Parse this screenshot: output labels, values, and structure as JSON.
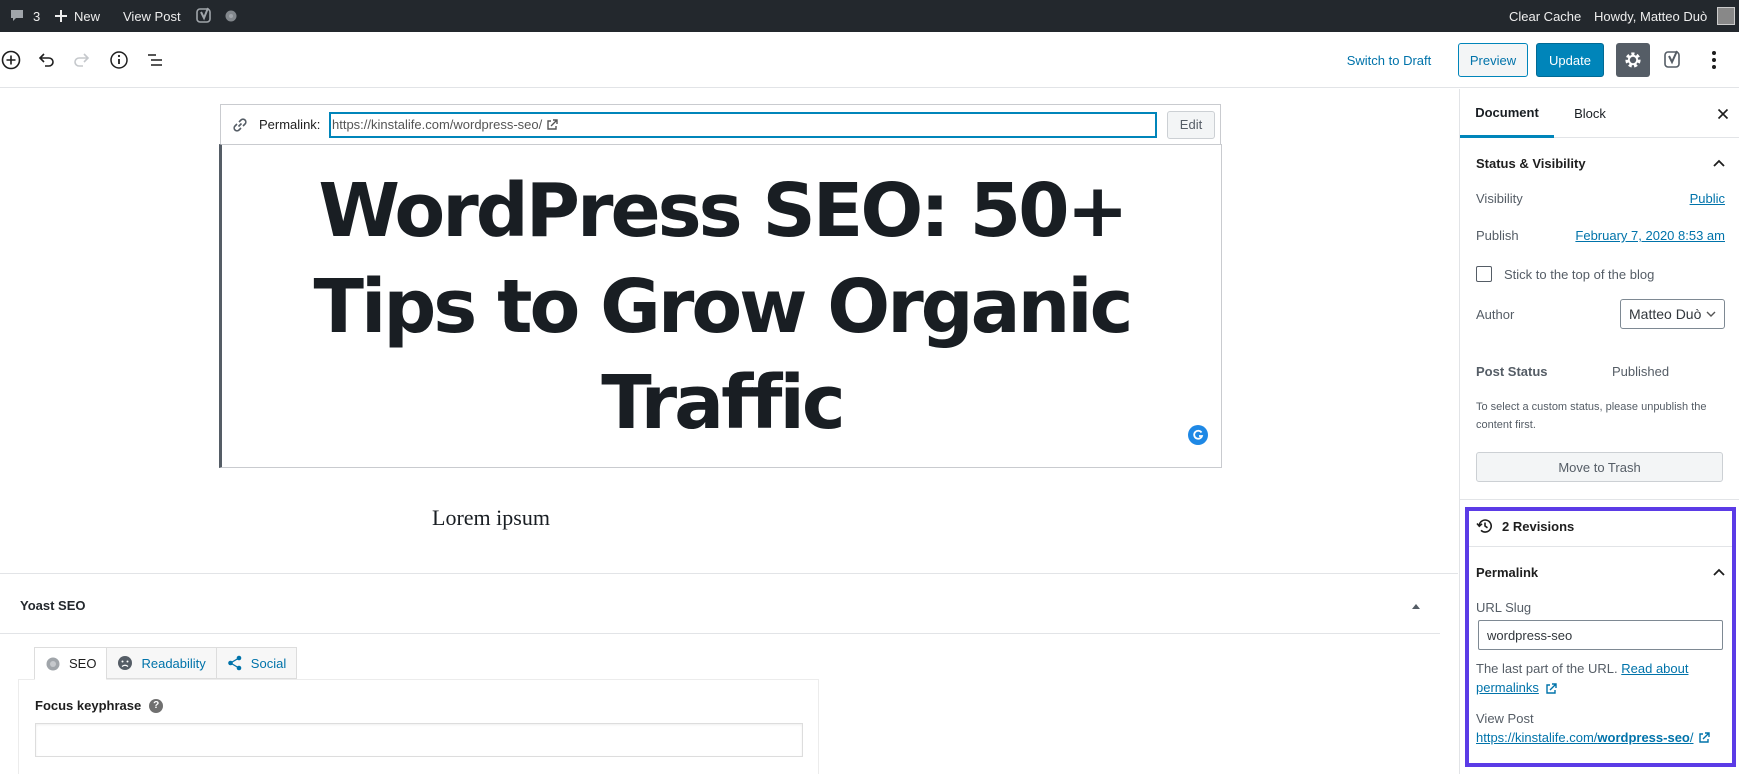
{
  "admin_bar": {
    "comments_count": "3",
    "new_label": "New",
    "view_post_label": "View Post",
    "clear_cache_label": "Clear Cache",
    "howdy_label": "Howdy, Matteo Duò"
  },
  "toolbar": {
    "switch_to_draft_label": "Switch to Draft",
    "preview_label": "Preview",
    "update_label": "Update"
  },
  "editor": {
    "permalink_label": "Permalink:",
    "permalink_url": "https://kinstalife.com/wordpress-seo/",
    "edit_label": "Edit",
    "title": "WordPress SEO: 50+ Tips to Grow Organic Traffic",
    "paragraph": "Lorem ipsum"
  },
  "yoast": {
    "panel_title": "Yoast SEO",
    "tabs": [
      {
        "label": "SEO"
      },
      {
        "label": "Readability"
      },
      {
        "label": "Social"
      }
    ],
    "focus_keyphrase_label": "Focus keyphrase",
    "focus_keyphrase_value": ""
  },
  "sidebar": {
    "tabs": [
      {
        "label": "Document"
      },
      {
        "label": "Block"
      }
    ],
    "status_visibility": {
      "heading": "Status & Visibility",
      "visibility_label": "Visibility",
      "visibility_value": "Public",
      "publish_label": "Publish",
      "publish_value": "February 7, 2020 8:53 am",
      "sticky_label": "Stick to the top of the blog",
      "author_label": "Author",
      "author_value": "Matteo Duò",
      "post_status_label": "Post Status",
      "post_status_value": "Published",
      "status_note": "To select a custom status, please unpublish the content first.",
      "trash_label": "Move to Trash"
    },
    "revisions_label": "2 Revisions",
    "permalink": {
      "heading": "Permalink",
      "url_slug_label": "URL Slug",
      "url_slug_value": "wordpress-seo",
      "help_text": "The last part of the URL.",
      "read_about_link_1": "Read about",
      "read_about_link_2": "permalinks",
      "view_post_label": "View Post",
      "view_post_url_prefix": "https://kinstalife.com/",
      "view_post_url_slug": "wordpress-seo",
      "view_post_url_suffix": "/"
    }
  },
  "colors": {
    "admin_bar_bg": "#23282d",
    "primary": "#0085ba",
    "link": "#0073aa",
    "highlight": "#5b3be6"
  }
}
